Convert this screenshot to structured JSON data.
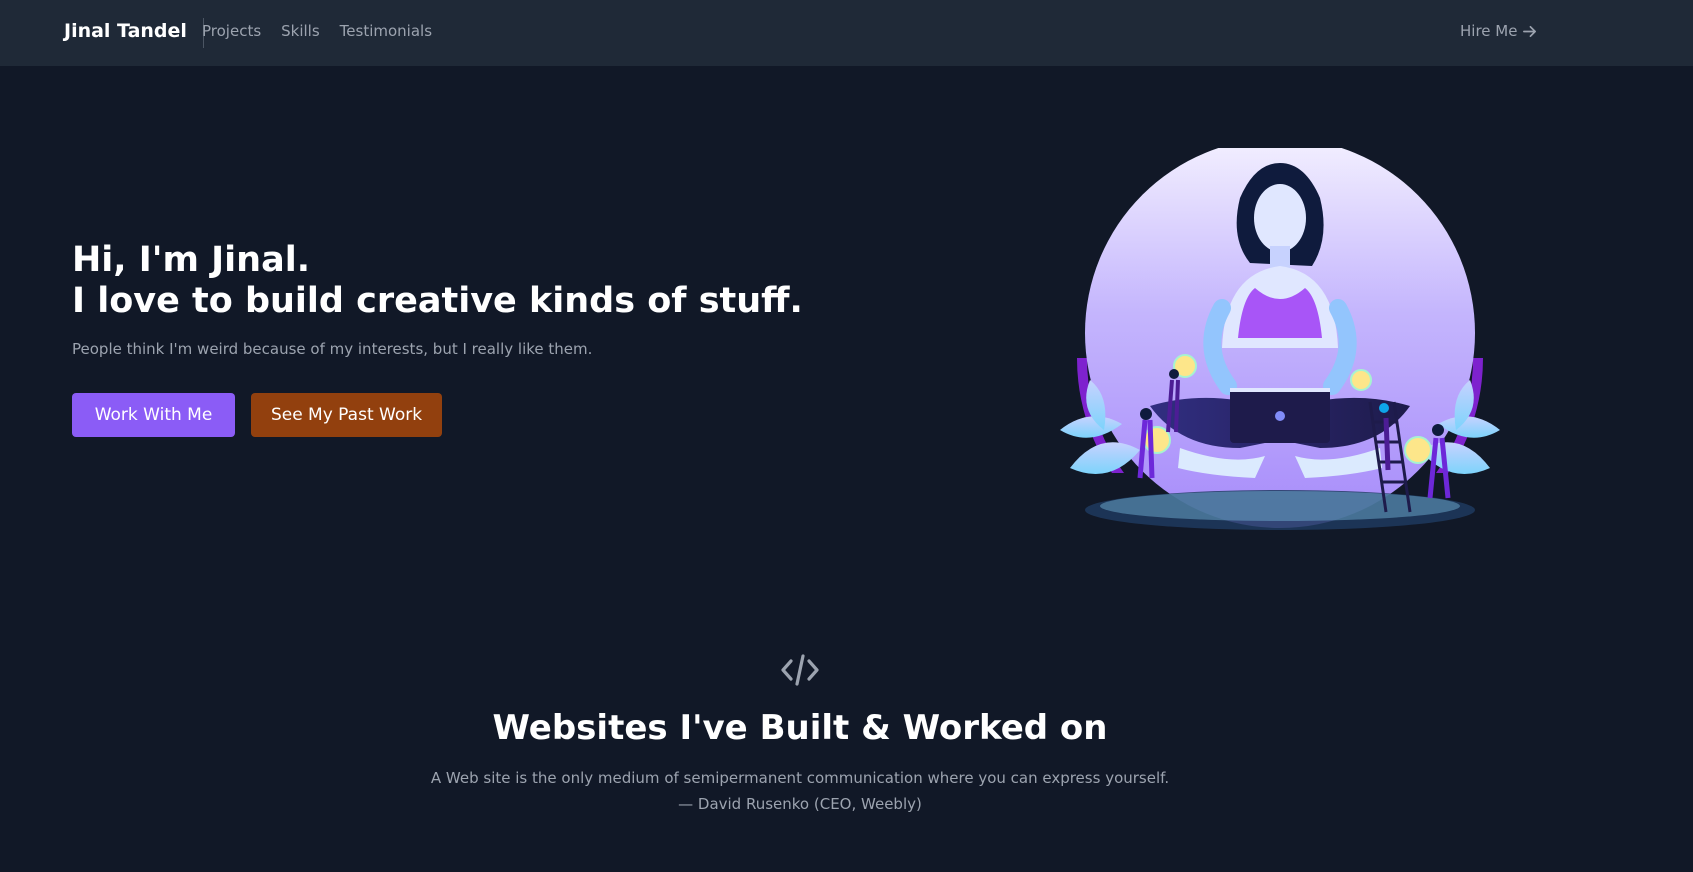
{
  "navbar": {
    "brand": "Jinal Tandel",
    "links": [
      "Projects",
      "Skills",
      "Testimonials"
    ],
    "cta": "Hire Me",
    "cta_icon": "arrow-right-icon"
  },
  "hero": {
    "title_line1": "Hi, I'm Jinal.",
    "title_line2": "I love to build creative kinds of stuff.",
    "subtitle": "People think I'm weird because of my interests, but I really like them.",
    "primary_button": "Work With Me",
    "secondary_button": "See My Past Work",
    "illustration": "woman-with-laptop-illustration"
  },
  "projects": {
    "icon": "code-icon",
    "title": "Websites I've Built & Worked on",
    "quote": "A Web site is the only medium of semipermanent communication where you can express yourself.",
    "attribution": "— David Rusenko (CEO, Weebly)"
  },
  "colors": {
    "background": "#111827",
    "navbar": "#1f2937",
    "primary": "#8b5cf6",
    "secondary": "#92400e",
    "muted_text": "#9ca3af"
  }
}
